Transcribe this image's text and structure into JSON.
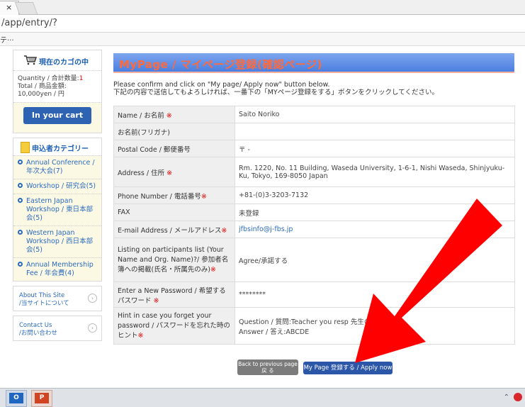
{
  "browser": {
    "tab_close": "×",
    "address": "/app/entry/?",
    "bookmark": "テ···"
  },
  "sidebar": {
    "cart": {
      "title": "現在のカゴの中",
      "quantity_label": "Quantity / 合計数量:",
      "quantity_value": "1",
      "total_label": "Total / 商品金額:",
      "total_value": "10,000yen / 円",
      "button": "In your cart"
    },
    "categories": {
      "title": "申込者カテゴリー",
      "items": [
        {
          "label": "Annual Conference / 年次大会(7)"
        },
        {
          "label": "Workshop / 研究会(5)"
        },
        {
          "label": "Eastern Japan Workshop / 東日本部会(5)"
        },
        {
          "label": "Western Japan Workshop / 西日本部会(5)"
        },
        {
          "label": "Annual Membership Fee / 年会費(4)"
        }
      ]
    },
    "links": [
      {
        "line1": "About This Site",
        "line2": "/当サイトについて"
      },
      {
        "line1": "Contact Us",
        "line2": "/お問い合わせ"
      }
    ]
  },
  "main": {
    "title": "MyPage / マイページ登録(確認ページ)",
    "instruction_en": "Please confirm and click on \"My page/ Apply now\" button below.",
    "instruction_ja": "下記の内容で送信してもよろしければ、一番下の「MYページ登録をする」ボタンをクリックしてください。",
    "rows": [
      {
        "label": "Name / お名前 ",
        "req": "※",
        "value": "Saito  Noriko"
      },
      {
        "label": "お名前(フリガナ)",
        "req": "",
        "value": ""
      },
      {
        "label": "Postal Code / 郵便番号",
        "req": "",
        "value": "〒 -"
      },
      {
        "label": "Address / 住所 ",
        "req": "※",
        "value": "Rm. 1220, No. 11 Building, Waseda University, 1-6-1, Nishi Waseda, Shinjyuku-Ku, Tokyo, 169-8050 Japan"
      },
      {
        "label": "Phone Number / 電話番号",
        "req": "※",
        "value": "+81-(0)3-3203-7132"
      },
      {
        "label": "FAX",
        "req": "",
        "value": "未登録"
      },
      {
        "label": "E-mail Address / メールアドレス",
        "req": "※",
        "value": "jfbsinfo@j-fbs.jp"
      },
      {
        "label": "Listing on participants list (Your Name and Org. Name)?/ 参加者名簿への掲載(氏名・所属先のみ)",
        "req": "※",
        "value": "Agree/承諾する"
      },
      {
        "label": "Enter a New Password / 希望するパスワード ",
        "req": "※",
        "value": "********"
      },
      {
        "label": "Hint in case you forget your password / パスワードを忘れた時のヒント",
        "req": "※",
        "value": "Question / 質問:Teacher you resp                              先生の名前は?\nAnswer / 答え:ABCDE"
      }
    ],
    "back_button_line1": "Back to previous page",
    "back_button_line2": "戻 る",
    "apply_button": "My Page 登録する / Apply now"
  },
  "taskbar": {
    "outlook": "O",
    "ppt": "P"
  },
  "colors": {
    "title_bar": "#4b7fe0",
    "title_text": "#ff6a3d",
    "required": "#ee0000",
    "cart_button": "#2e63b3",
    "arrow": "#ff0000"
  }
}
